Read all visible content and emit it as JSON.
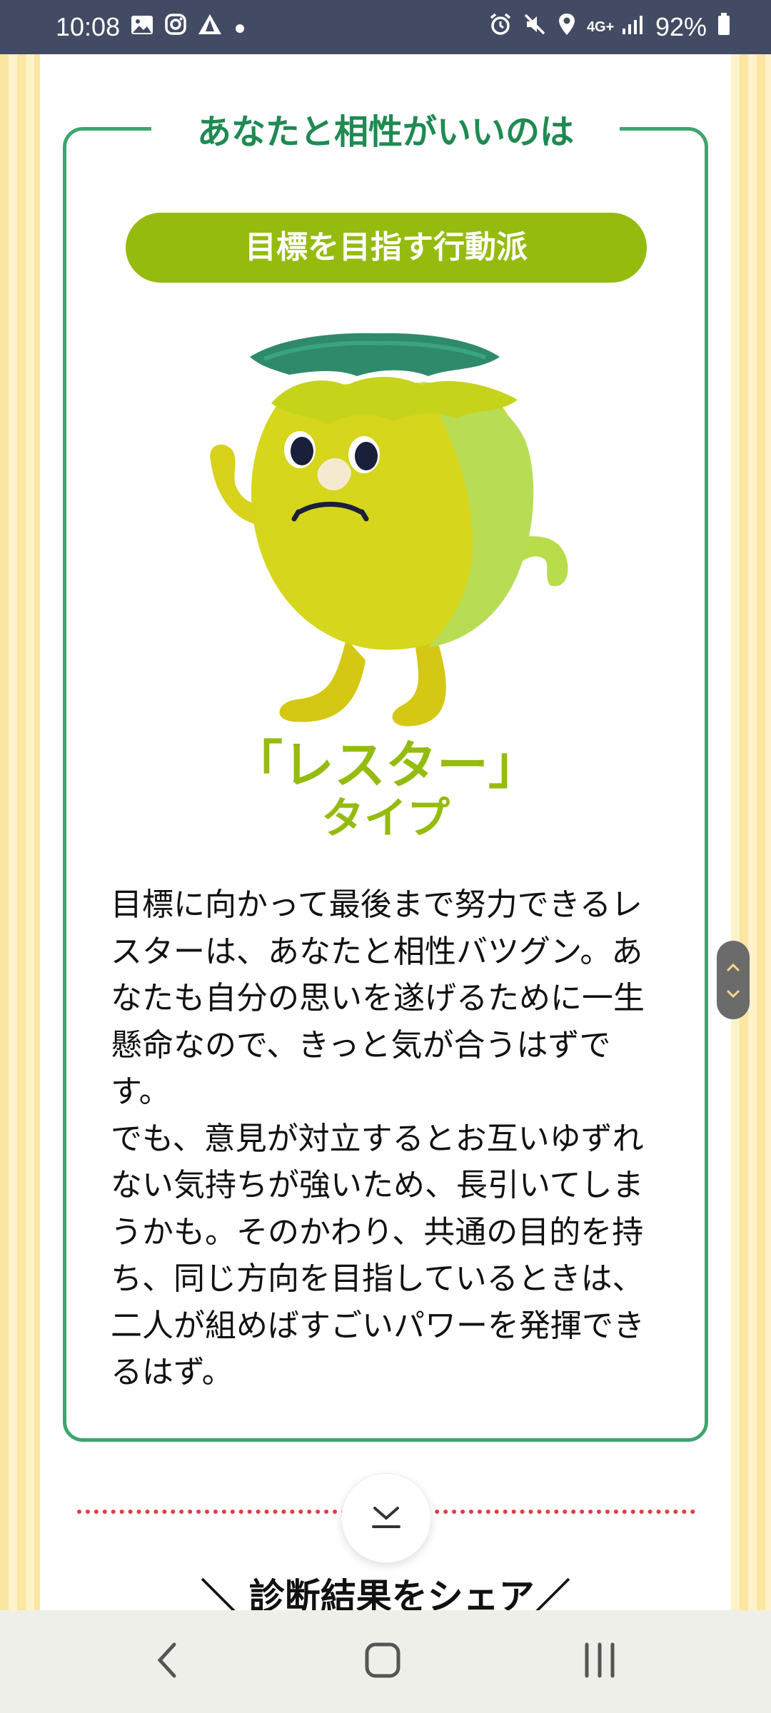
{
  "status_bar": {
    "time": "10:08",
    "network": "4G+",
    "battery": "92%",
    "icons_left": [
      "gallery-icon",
      "instagram-icon",
      "warning-icon",
      "dot-icon"
    ],
    "icons_right": [
      "alarm-icon",
      "mute-icon",
      "location-icon",
      "signal-icon",
      "battery-icon"
    ]
  },
  "card": {
    "title": "あなたと相性がいいのは",
    "badge": "目標を目指す行動派",
    "type_name": "「レスター」",
    "type_suffix": "タイプ",
    "description": [
      "目標に向かって最後まで努力できるレスターは、あなたと相性バツグン。あなたも自分の思いを遂げるために一生懸命なので、きっと気が合うはずです。",
      "でも、意見が対立するとお互いゆずれない気持ちが強いため、長引いてしまうかも。そのかわり、共通の目的を持ち、同じ方向を目指しているときは、二人が組めばすごいパワーを発揮できるはず。"
    ]
  },
  "share_heading": "＼ 診断結果をシェア／",
  "colors": {
    "accent_green": "#95bb0f",
    "frame_green": "#3da66e",
    "title_green": "#1f8a52",
    "dots_red": "#e53a44",
    "status_bar": "#434a63"
  },
  "nav": {
    "buttons": [
      "back-icon",
      "home-icon",
      "recents-icon"
    ]
  }
}
